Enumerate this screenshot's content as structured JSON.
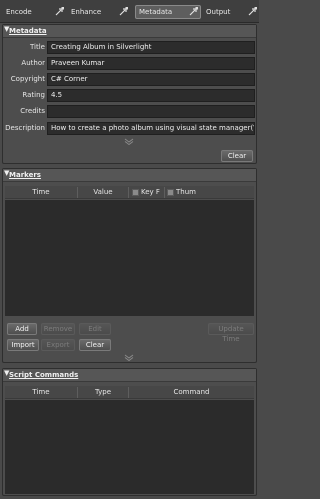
{
  "tabs": [
    {
      "label": "Encode",
      "active": false
    },
    {
      "label": "Enhance",
      "active": false
    },
    {
      "label": "Metadata",
      "active": true
    },
    {
      "label": "Output",
      "active": false
    }
  ],
  "metadata": {
    "title": "Metadata",
    "fields": [
      {
        "label": "Title",
        "value": "Creating Album in Silverlight"
      },
      {
        "label": "Author",
        "value": "Praveen Kumar"
      },
      {
        "label": "Copyright",
        "value": "C# Corner"
      },
      {
        "label": "Rating",
        "value": "4.5"
      },
      {
        "label": "Credits",
        "value": ""
      },
      {
        "label": "Description",
        "value": "How to create a photo album using visual state manager(V..."
      }
    ],
    "clear_label": "Clear"
  },
  "markers": {
    "title": "Markers",
    "columns": {
      "time": "Time",
      "value": "Value",
      "keyframe": "Key F",
      "thumbnail": "Thum"
    },
    "buttons": {
      "add": "Add",
      "remove": "Remove",
      "edit": "Edit",
      "update_time": "Update Time",
      "import": "Import",
      "export": "Export",
      "clear": "Clear"
    }
  },
  "script_commands": {
    "title": "Script Commands",
    "columns": {
      "time": "Time",
      "type": "Type",
      "command": "Command"
    }
  },
  "colors": {
    "accent_active_tab": "#5e5e5e",
    "field_bg": "#2c2c2c",
    "panel_bg": "#4d4d4d"
  }
}
